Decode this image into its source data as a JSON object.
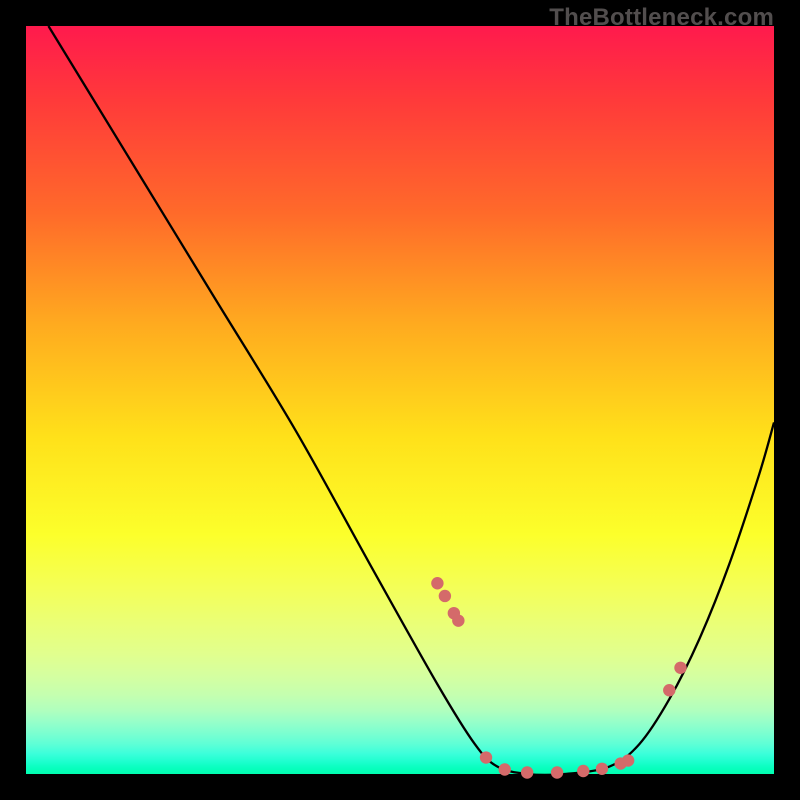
{
  "attribution": "TheBottleneck.com",
  "chart_data": {
    "type": "line",
    "title": "",
    "xlabel": "",
    "ylabel": "",
    "xlim": [
      0,
      100
    ],
    "ylim": [
      0,
      100
    ],
    "curve": {
      "x": [
        3,
        14,
        25,
        36,
        46,
        55,
        60,
        63,
        67,
        72,
        78,
        82,
        86,
        90,
        94,
        98,
        100
      ],
      "y": [
        100,
        82,
        64,
        46,
        28,
        12,
        4,
        1,
        0,
        0,
        1,
        4,
        10,
        18,
        28,
        40,
        47
      ]
    },
    "series": [
      {
        "name": "markers",
        "x": [
          55,
          56,
          57.2,
          57.8,
          61.5,
          64,
          67,
          71,
          74.5,
          77,
          79.5,
          80.5,
          86,
          87.5
        ],
        "y": [
          25.5,
          23.8,
          21.5,
          20.5,
          2.2,
          0.6,
          0.2,
          0.2,
          0.4,
          0.7,
          1.4,
          1.8,
          11.2,
          14.2
        ]
      }
    ],
    "marker_color": "#d46a6a",
    "background_gradient": {
      "top": "#ff1a4d",
      "bottom": "#00ffb0"
    }
  }
}
